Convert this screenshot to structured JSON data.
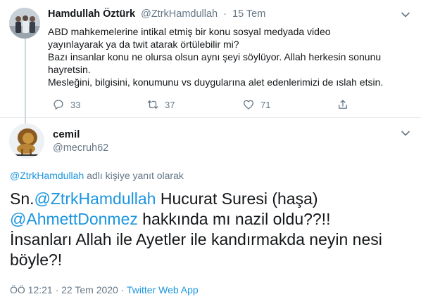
{
  "parent_tweet": {
    "author_name": "Hamdullah Öztürk",
    "handle": "@ZtrkHamdullah",
    "separator": "·",
    "date": "15 Tem",
    "body_lines": [
      "ABD mahkemelerine intikal etmiş bir konu sosyal medyada video",
      "yayınlayarak ya da twit atarak örtülebilir mi?",
      "Bazı insanlar konu ne olursa olsun aynı şeyi söylüyor. Allah herkesin sonunu",
      "hayretsin.",
      "Mesleğini, bilgisini, konumunu vs duygularına alet edenlerimizi de ıslah etsin."
    ],
    "reply_count": "33",
    "retweet_count": "37",
    "like_count": "71"
  },
  "main_tweet": {
    "author_name": "cemil",
    "handle": "@mecruh62",
    "replying_handle": "@ZtrkHamdullah",
    "replying_suffix": " adlı kişiye yanıt olarak",
    "line1_prefix": "Sn.",
    "mention1": "@ZtrkHamdullah",
    "line1_suffix": " Hucurat Suresi (haşa)",
    "mention2": "@AhmettDonmez",
    "line2_suffix": " hakkında mı nazil oldu??!!",
    "line3": "İnsanları Allah ile Ayetler ile kandırmakda neyin nesi",
    "line4": "böyle?!",
    "timestamp": "ÖÖ 12:21 · 22 Tem 2020 · ",
    "source": "Twitter Web App"
  },
  "icons": {
    "reply": "reply-icon",
    "retweet": "retweet-icon",
    "like": "heart-icon",
    "share": "share-icon",
    "more": "chevron-down-icon"
  },
  "colors": {
    "link": "#1b95e0",
    "secondary_text": "#657786",
    "primary_text": "#14171a",
    "divider": "#e6ecf0"
  }
}
